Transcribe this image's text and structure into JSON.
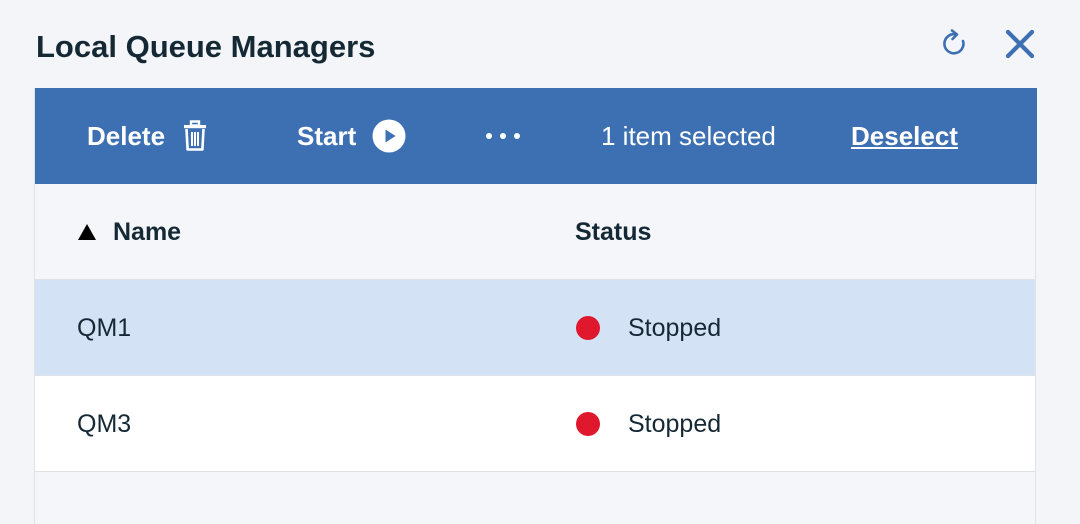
{
  "widget": {
    "title": "Local Queue Managers",
    "actions": {
      "refresh_icon": "refresh-icon",
      "close_icon": "close-icon"
    }
  },
  "batch_actions": {
    "delete_label": "Delete",
    "delete_icon": "trash-icon",
    "start_label": "Start",
    "start_icon": "play-icon",
    "overflow_icon": "more-horizontal-icon",
    "selection_text": "1 item selected",
    "deselect_label": "Deselect"
  },
  "table": {
    "columns": [
      {
        "label": "Name",
        "sort": "ascending"
      },
      {
        "label": "Status"
      }
    ],
    "rows": [
      {
        "name": "QM1",
        "status": "Stopped",
        "selected": true
      },
      {
        "name": "QM3",
        "status": "Stopped",
        "selected": false
      }
    ]
  },
  "colors": {
    "accent": "#3d70b2",
    "selected_row": "#d4e2f6",
    "status_stopped": "#e0182d",
    "text": "#152935"
  }
}
